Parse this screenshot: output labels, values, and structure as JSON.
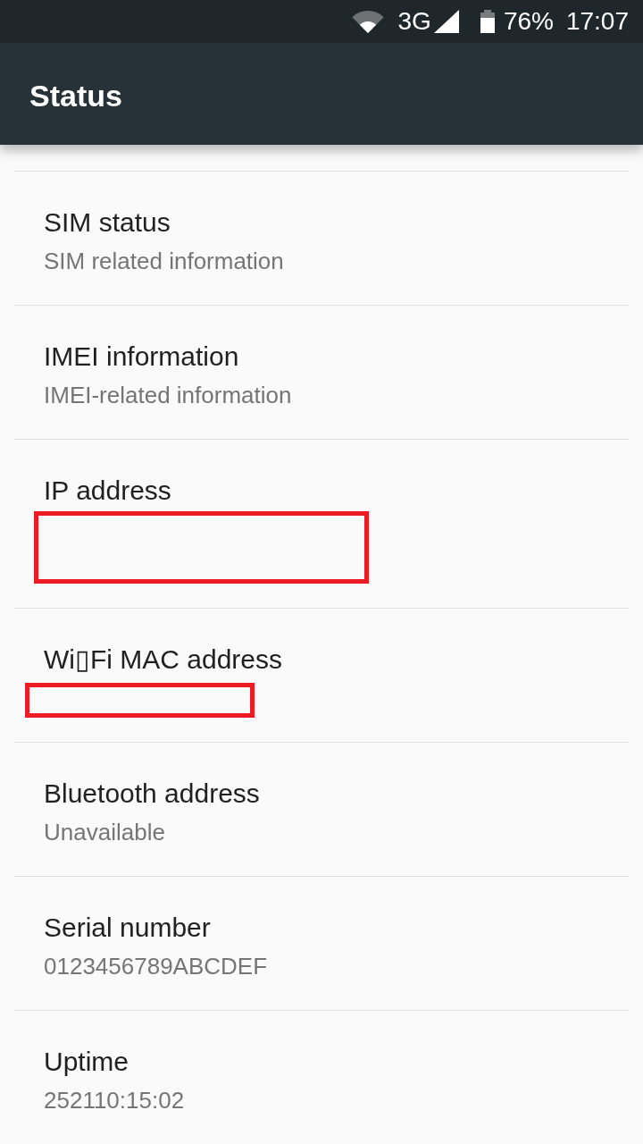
{
  "status_bar": {
    "network": "3G",
    "battery": "76%",
    "time": "17:07"
  },
  "toolbar": {
    "title": "Status"
  },
  "items": [
    {
      "title": "SIM status",
      "kind": "summary",
      "summary": "SIM related information"
    },
    {
      "title": "IMEI information",
      "kind": "summary",
      "summary": "IMEI-related information"
    },
    {
      "title": "IP address",
      "kind": "redaction_block"
    },
    {
      "title": "Wi▯Fi MAC address",
      "kind": "redaction_line"
    },
    {
      "title": "Bluetooth address",
      "kind": "summary",
      "summary": "Unavailable"
    },
    {
      "title": "Serial number",
      "kind": "summary",
      "summary": "0123456789ABCDEF"
    },
    {
      "title": "Uptime",
      "kind": "summary",
      "summary": "252110:15:02"
    }
  ]
}
